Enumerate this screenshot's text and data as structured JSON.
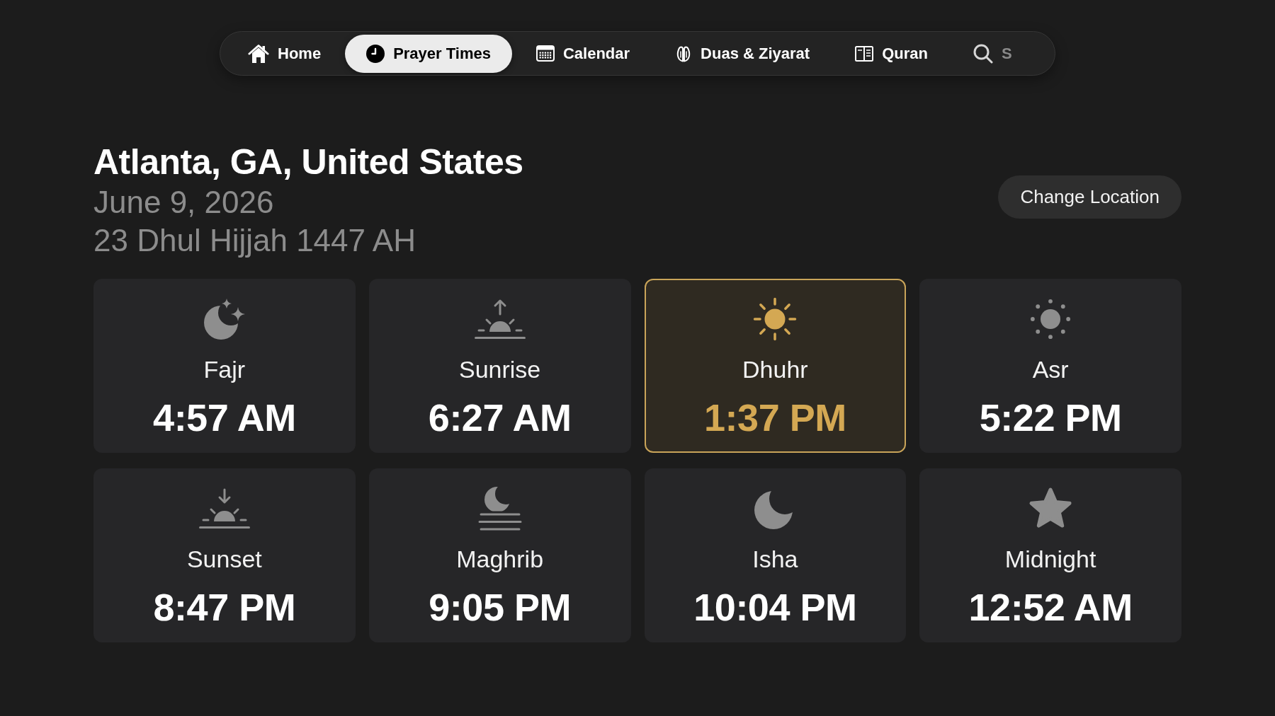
{
  "nav": {
    "items": [
      {
        "kind": "home",
        "label": "Home",
        "selected": false
      },
      {
        "kind": "prayer_times",
        "label": "Prayer Times",
        "selected": true
      },
      {
        "kind": "calendar",
        "label": "Calendar",
        "selected": false
      },
      {
        "kind": "duas",
        "label": "Duas & Ziyarat",
        "selected": false
      },
      {
        "kind": "quran",
        "label": "Quran",
        "selected": false
      },
      {
        "kind": "search",
        "label": "S",
        "selected": false
      }
    ]
  },
  "location": {
    "title": "Atlanta, GA, United States",
    "gregorian_date": "June 9, 2026",
    "hijri_date": "23 Dhul Hijjah 1447 AH",
    "change_button": "Change Location"
  },
  "prayer_times": [
    {
      "kind": "fajr",
      "name": "Fajr",
      "time": "4:57 AM",
      "selected": false
    },
    {
      "kind": "sunrise",
      "name": "Sunrise",
      "time": "6:27 AM",
      "selected": false
    },
    {
      "kind": "dhuhr",
      "name": "Dhuhr",
      "time": "1:37 PM",
      "selected": true
    },
    {
      "kind": "asr",
      "name": "Asr",
      "time": "5:22 PM",
      "selected": false
    },
    {
      "kind": "sunset",
      "name": "Sunset",
      "time": "8:47 PM",
      "selected": false
    },
    {
      "kind": "maghrib",
      "name": "Maghrib",
      "time": "9:05 PM",
      "selected": false
    },
    {
      "kind": "isha",
      "name": "Isha",
      "time": "10:04 PM",
      "selected": false
    },
    {
      "kind": "midnight",
      "name": "Midnight",
      "time": "12:52 AM",
      "selected": false
    }
  ]
}
